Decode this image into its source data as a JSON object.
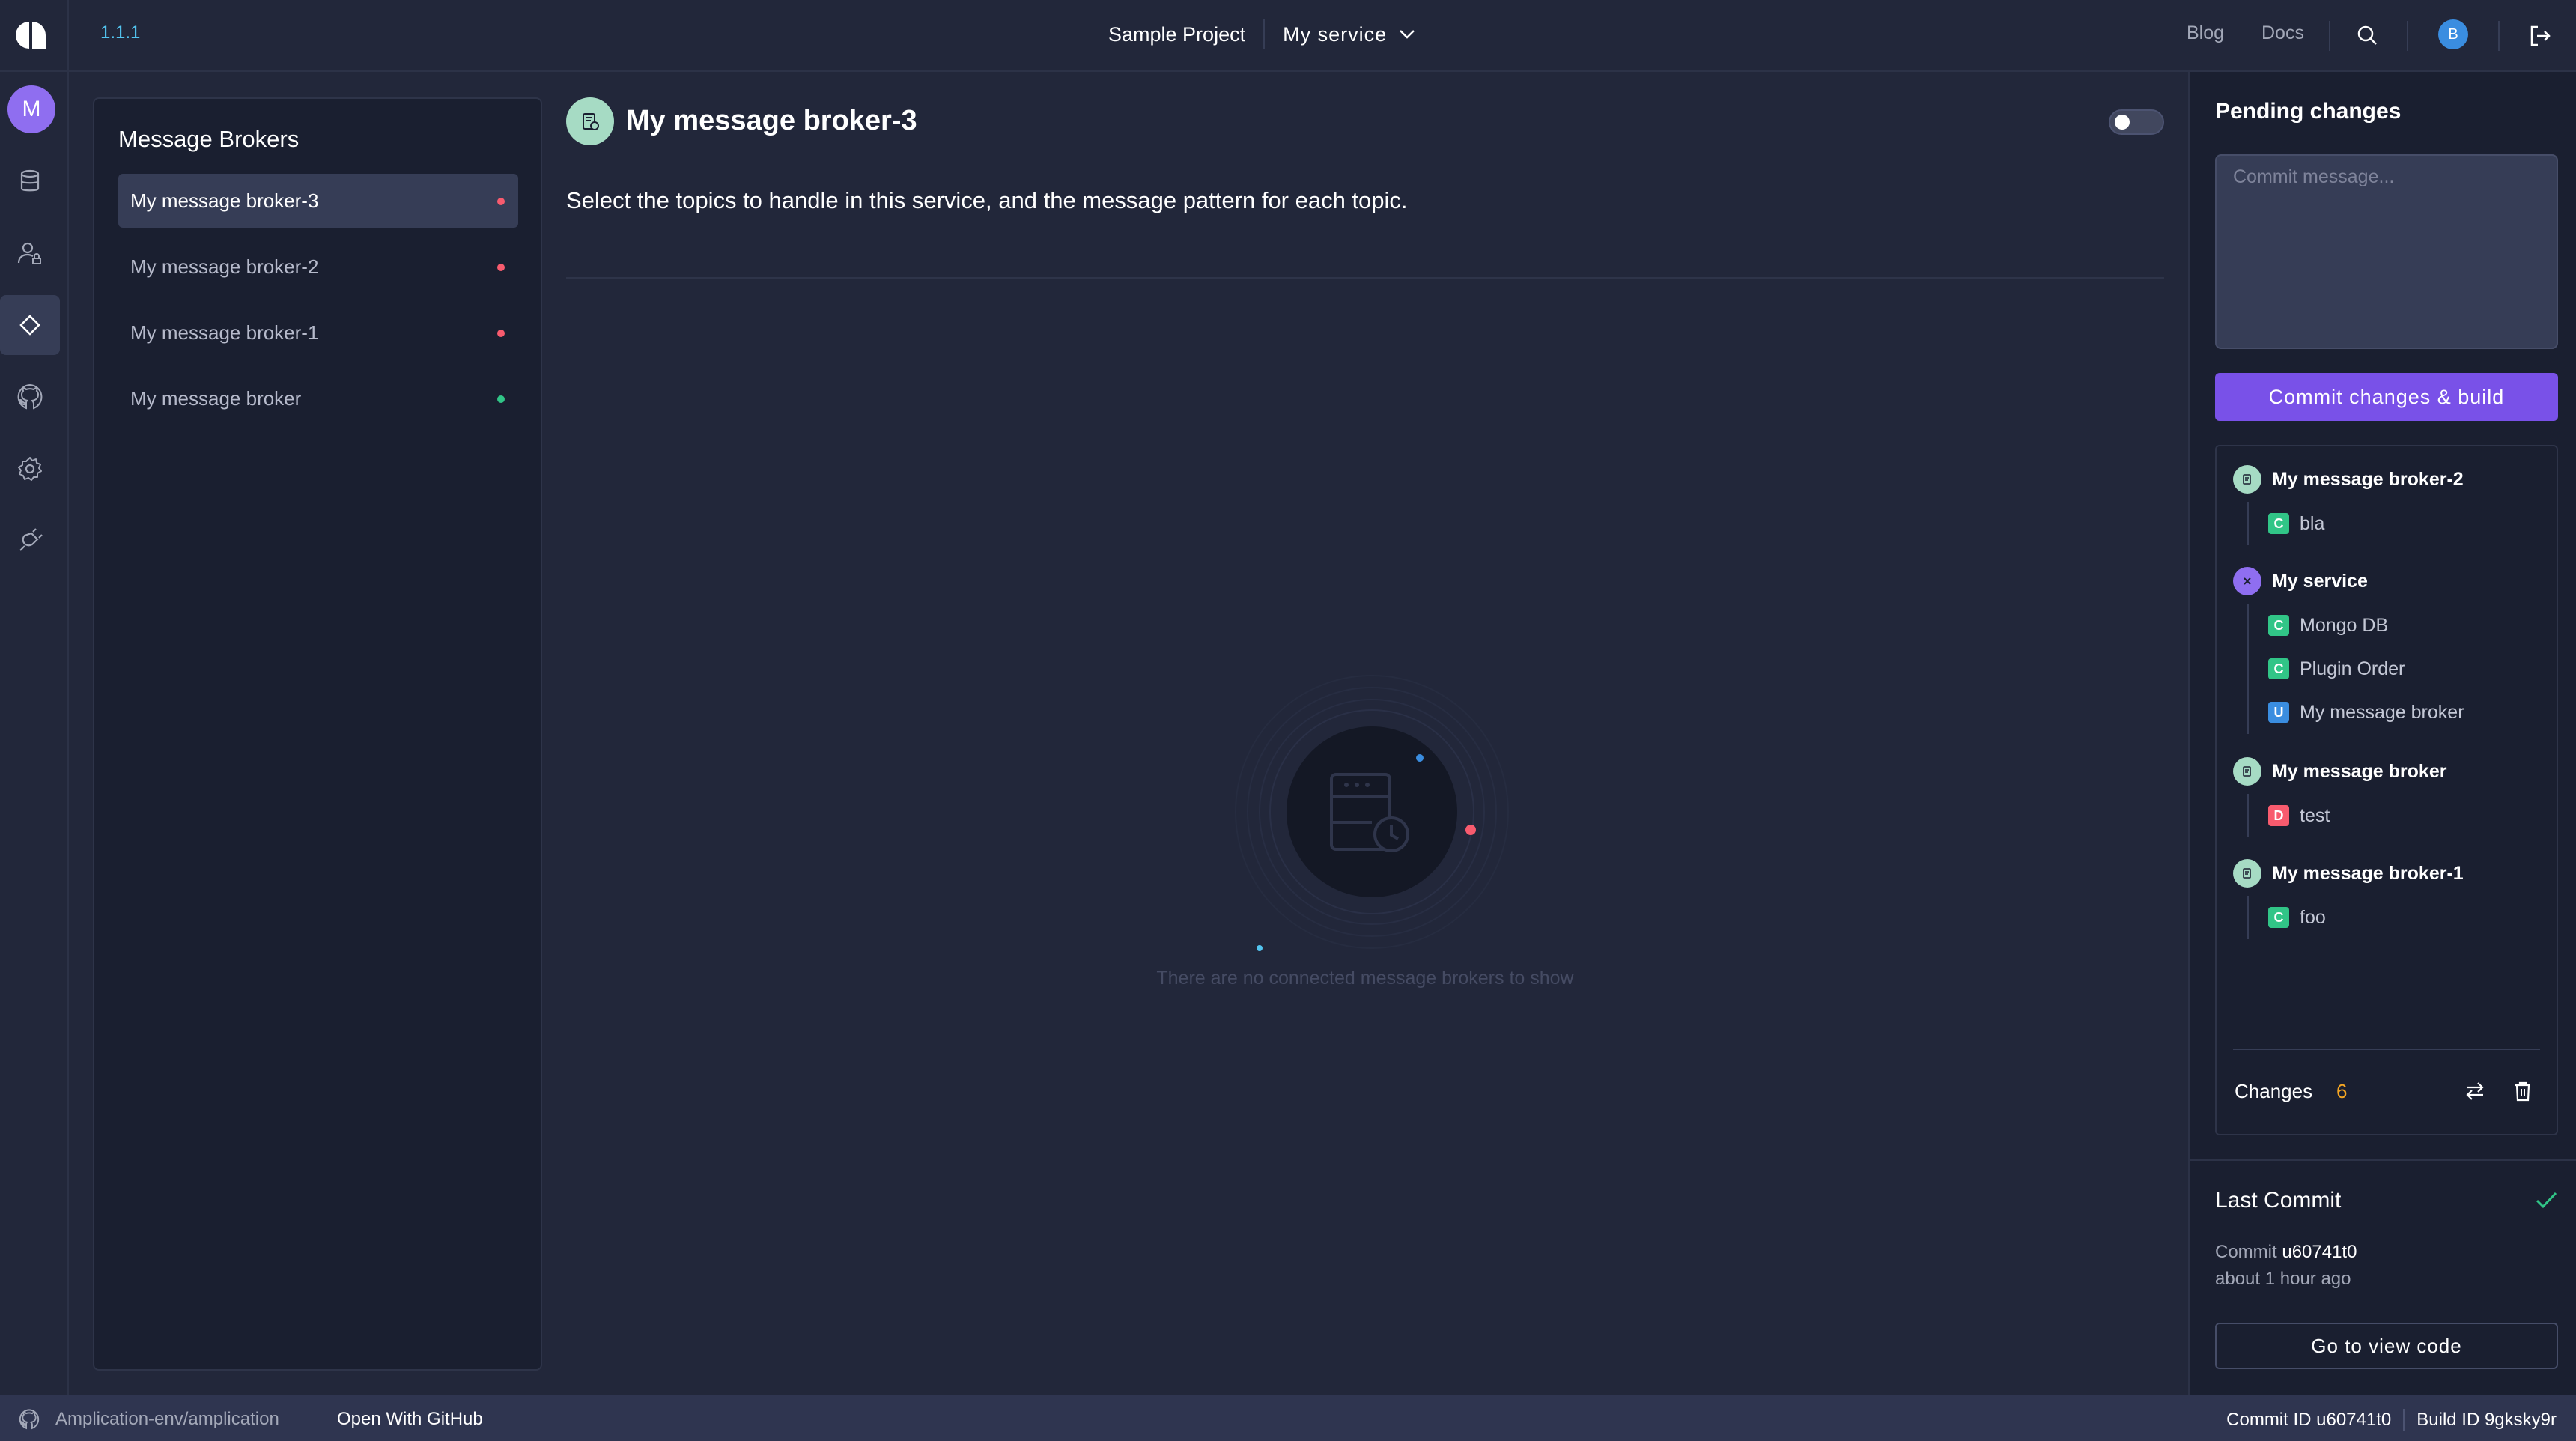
{
  "header": {
    "version": "1.1.1",
    "project_name": "Sample Project",
    "service_name": "My service",
    "blog_label": "Blog",
    "docs_label": "Docs",
    "user_initial": "B"
  },
  "rail": {
    "workspace_initial": "M",
    "items": [
      {
        "name": "entities",
        "icon": "database-icon"
      },
      {
        "name": "roles",
        "icon": "user-role-icon"
      },
      {
        "name": "connections",
        "icon": "connection-icon",
        "active": true
      },
      {
        "name": "sync-github",
        "icon": "github-icon"
      },
      {
        "name": "settings",
        "icon": "gear-icon"
      },
      {
        "name": "plugins",
        "icon": "plug-icon"
      }
    ]
  },
  "broker_list": {
    "title": "Message Brokers",
    "items": [
      {
        "label": "My message broker-3",
        "status_color": "#f85b6e",
        "active": true
      },
      {
        "label": "My message broker-2",
        "status_color": "#f85b6e"
      },
      {
        "label": "My message broker-1",
        "status_color": "#f85b6e"
      },
      {
        "label": "My message broker",
        "status_color": "#31c587"
      }
    ]
  },
  "main": {
    "broker_title": "My message broker-3",
    "description": "Select the topics to handle in this service, and the message pattern for each topic.",
    "empty_message": "There are no connected message brokers to show",
    "toggle_on": false
  },
  "pending": {
    "title": "Pending changes",
    "commit_placeholder": "Commit message...",
    "commit_button": "Commit changes & build",
    "groups": [
      {
        "label": "My message broker-2",
        "icon": "message-broker-icon",
        "icon_color": "#a6dbc4",
        "changes": [
          {
            "badge": "C",
            "label": "bla"
          }
        ]
      },
      {
        "label": "My service",
        "icon": "service-icon",
        "icon_color": "#8f6ef0",
        "changes": [
          {
            "badge": "C",
            "label": "Mongo DB"
          },
          {
            "badge": "C",
            "label": "Plugin Order"
          },
          {
            "badge": "U",
            "label": "My message broker"
          }
        ]
      },
      {
        "label": "My message broker",
        "icon": "message-broker-icon",
        "icon_color": "#a6dbc4",
        "changes": [
          {
            "badge": "D",
            "label": "test"
          }
        ]
      },
      {
        "label": "My message broker-1",
        "icon": "message-broker-icon",
        "icon_color": "#a6dbc4",
        "changes": [
          {
            "badge": "C",
            "label": "foo"
          }
        ]
      }
    ],
    "changes_label": "Changes",
    "changes_count": "6"
  },
  "badge_colors": {
    "C": "#31c587",
    "U": "#3a8de0",
    "D": "#f85b6e"
  },
  "last_commit": {
    "title": "Last Commit",
    "commit_prefix": "Commit",
    "commit_hash": "u60741t0",
    "time_ago": "about 1 hour ago",
    "view_code_button": "Go to view code"
  },
  "status_bar": {
    "repo": "Amplication-env/amplication",
    "open_github": "Open With GitHub",
    "commit_id": "Commit ID u60741t0",
    "build_id": "Build ID 9gksky9r"
  }
}
